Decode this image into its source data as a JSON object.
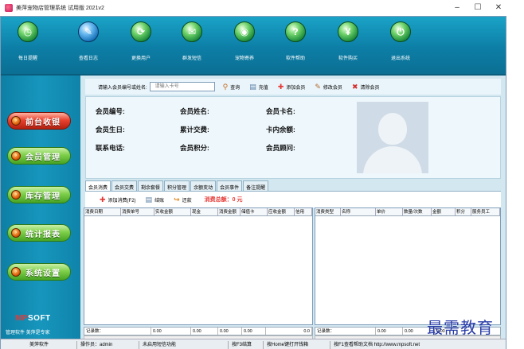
{
  "window": {
    "title": "美萍宠物店管理系统 试用版 2021v2",
    "controls": [
      "–",
      "☐",
      "✕"
    ]
  },
  "toolbar": {
    "items": [
      {
        "label": "每日提醒",
        "icon": "clock-icon",
        "glyph": "◷"
      },
      {
        "label": "查看日志",
        "icon": "log-icon",
        "glyph": "✎"
      },
      {
        "label": "更换用户",
        "icon": "switch-user-icon",
        "glyph": "⟳"
      },
      {
        "label": "群发短信",
        "icon": "sms-icon",
        "glyph": "✉"
      },
      {
        "label": "宠物寄养",
        "icon": "pet-boarding-icon",
        "glyph": "◉"
      },
      {
        "label": "软件帮助",
        "icon": "help-icon",
        "glyph": "?"
      },
      {
        "label": "软件购买",
        "icon": "purchase-icon",
        "glyph": "¥"
      },
      {
        "label": "退出系统",
        "icon": "power-icon",
        "glyph": "⏻"
      }
    ]
  },
  "sidebar": {
    "items": [
      {
        "label": "前台收银",
        "active": true
      },
      {
        "label": "会员管理",
        "active": false
      },
      {
        "label": "库存管理",
        "active": false
      },
      {
        "label": "统计报表",
        "active": false
      },
      {
        "label": "系统设置",
        "active": false
      }
    ],
    "logo_mp": "MP",
    "logo_soft": "SOFT",
    "logo_sub": "管理软件  美萍是专家"
  },
  "search": {
    "label": "请输入会员编号或姓名:",
    "placeholder": "请输入卡号"
  },
  "actions": {
    "query": "查询",
    "recharge": "充值",
    "add_member": "添加会员",
    "edit_member": "修改会员",
    "clear_member": "清除会员"
  },
  "member_fields": {
    "id": "会员编号:",
    "name": "会员姓名:",
    "card": "会员卡名:",
    "birthday": "会员生日:",
    "total_spend": "累计交费:",
    "balance": "卡内余额:",
    "phone": "联系电话:",
    "points": "会员积分:",
    "advisor": "会员顾问:"
  },
  "tabs": [
    "会员消费",
    "会员交费",
    "剩余套餐",
    "积分管理",
    "余额变动",
    "会员事件",
    "备注提醒"
  ],
  "subtoolbar": {
    "add_consume": "添加消费(F2)",
    "checkout": "结账",
    "return": "还款",
    "total_label": "消费总额：0 元"
  },
  "left_grid": {
    "columns": [
      "消费日期",
      "消费单号",
      "实收金额",
      "现金",
      "消费金额",
      "储值卡",
      "应收金额",
      "信用"
    ],
    "footer": [
      "记录数：",
      "0.00",
      "0.00",
      "0.00",
      "0.00",
      "0.0"
    ]
  },
  "right_grid": {
    "columns": [
      "消费类型",
      "名称",
      "单价",
      "数量/次数",
      "金额",
      "积分",
      "服务员工"
    ],
    "footer": [
      "记录数：",
      "0.00",
      "0.00",
      "0.00"
    ]
  },
  "statusbar": {
    "items": [
      "美萍软件",
      "操作员：admin",
      "未启用短信功能",
      "按F3结算",
      "按Home键打开钱箱",
      "按F1查看帮助文档  http://www.mpsoft.net"
    ]
  },
  "watermark": "最需教育",
  "colors": {
    "toolbar_bg": "#0d7ea6",
    "sidebar_button_green": "#7fcf4a",
    "sidebar_button_red": "#e9432f",
    "total_red": "#e53935"
  }
}
